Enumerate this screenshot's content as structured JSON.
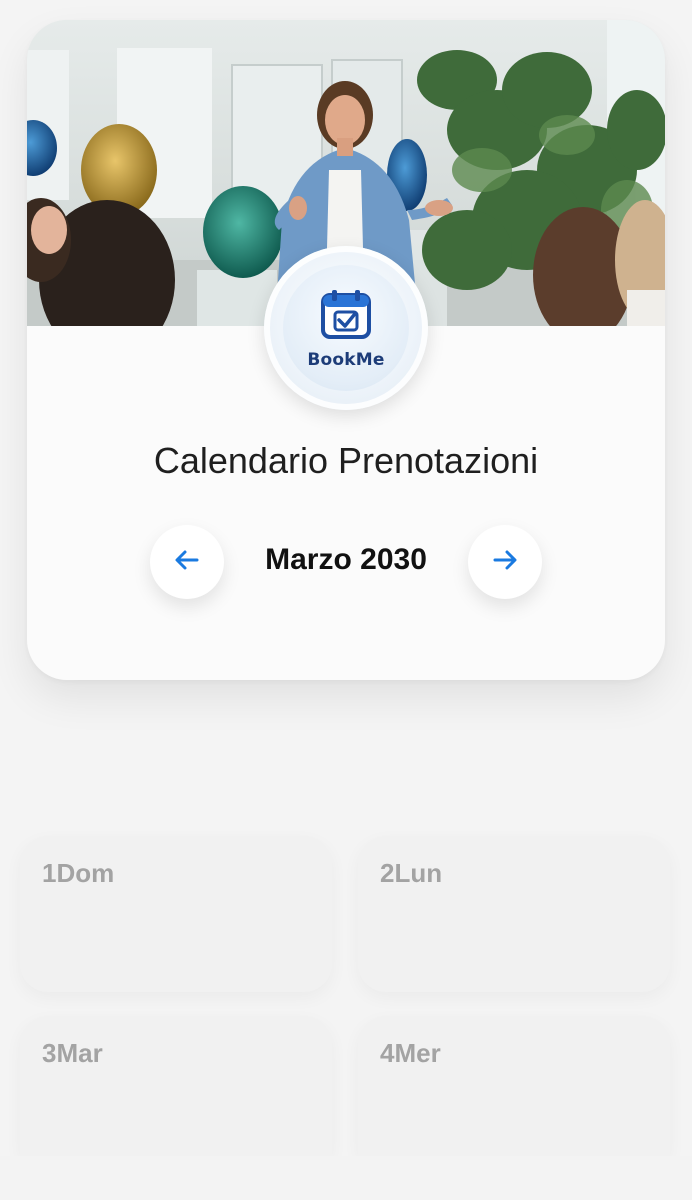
{
  "header": {
    "title": "Calendario Prenotazioni",
    "month_label": "Marzo 2030",
    "prev_icon": "arrow-left-icon",
    "next_icon": "arrow-right-icon"
  },
  "logo": {
    "text": "BookMe",
    "icon": "calendar-check-icon"
  },
  "days": [
    {
      "label": "1Dom"
    },
    {
      "label": "2Lun"
    },
    {
      "label": "3Mar"
    },
    {
      "label": "4Mer"
    }
  ],
  "colors": {
    "accent": "#1a7ae0",
    "logo_text": "#1d3c78",
    "day_label": "#a3a3a3"
  }
}
